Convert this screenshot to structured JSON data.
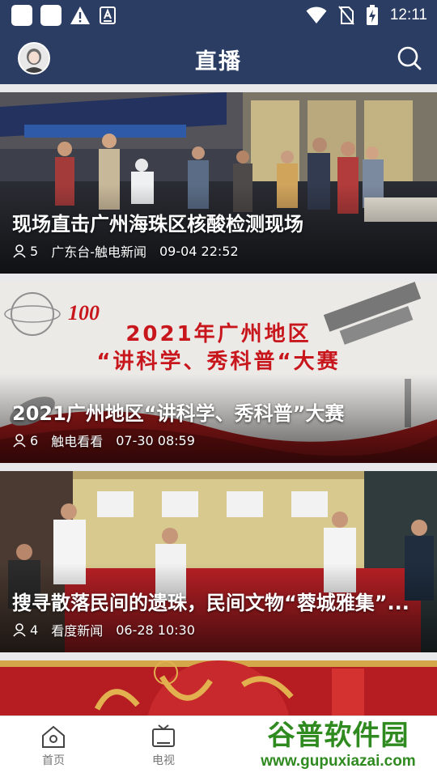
{
  "status_bar": {
    "time": "12:11"
  },
  "app_bar": {
    "title": "直播"
  },
  "feed": {
    "cards": [
      {
        "title": "现场直击广州海珠区核酸检测现场",
        "viewers": "5",
        "source": "广东台-触电新闻",
        "time": "09-04 22:52"
      },
      {
        "title": "2021广州地区“讲科学、秀科普”大赛",
        "viewers": "6",
        "source": "触电看看",
        "time": "07-30 08:59",
        "poster": {
          "logo_text": "100",
          "heading": "2021年广州地区",
          "subheading": "“讲科学、秀科普“大赛"
        }
      },
      {
        "title": "搜寻散落民间的遗珠，民间文物“蓉城雅集”...",
        "viewers": "4",
        "source": "看度新闻",
        "time": "06-28 10:30"
      }
    ]
  },
  "bottom_nav": {
    "items": [
      {
        "label": "首页",
        "icon": "home-icon"
      },
      {
        "label": "电视",
        "icon": "tv-icon"
      }
    ]
  },
  "watermark": {
    "top": "谷普软件园",
    "bottom": "www.gupuxiazai.com"
  },
  "colors": {
    "header": "#2b3d63",
    "nav_bg": "#ffffff",
    "watermark": "#2f8a1f"
  }
}
